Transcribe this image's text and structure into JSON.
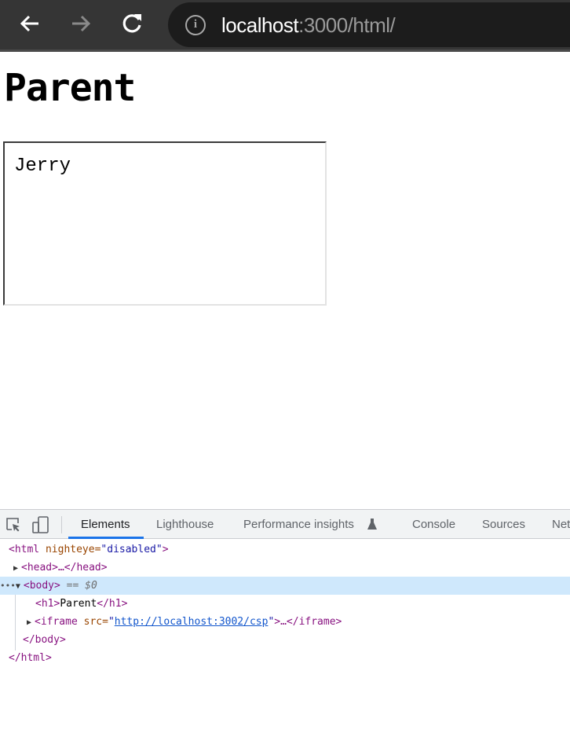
{
  "browser": {
    "url_host": "localhost",
    "url_rest": ":3000/html/",
    "icons": [
      "back-arrow-icon",
      "forward-arrow-icon",
      "reload-icon",
      "info-icon"
    ]
  },
  "page": {
    "heading": "Parent",
    "iframe_text": "Jerry"
  },
  "devtools": {
    "tabs": [
      "Elements",
      "Lighthouse",
      "Performance insights",
      "Console",
      "Sources",
      "Net"
    ],
    "active_tab": "Elements",
    "tree": {
      "html_open": "<html",
      "attr_nighteye": " nighteye=",
      "attr_nighteye_val": "\"disabled\"",
      "close": ">",
      "head": "<head>…</head>",
      "body_open": "<body>",
      "body_marker": " == $0",
      "h1_open": "<h1>",
      "h1_text": "Parent",
      "h1_close": "</h1>",
      "iframe_open": "<iframe",
      "attr_src": " src=",
      "quote": "\"",
      "src_val": "http://localhost:3002/csp",
      "iframe_rest": ">…</iframe>",
      "body_close": "</body>",
      "html_close": "</html>"
    },
    "colors": {
      "accent": "#1a73e8",
      "selected_row": "#cfe8fc"
    }
  }
}
